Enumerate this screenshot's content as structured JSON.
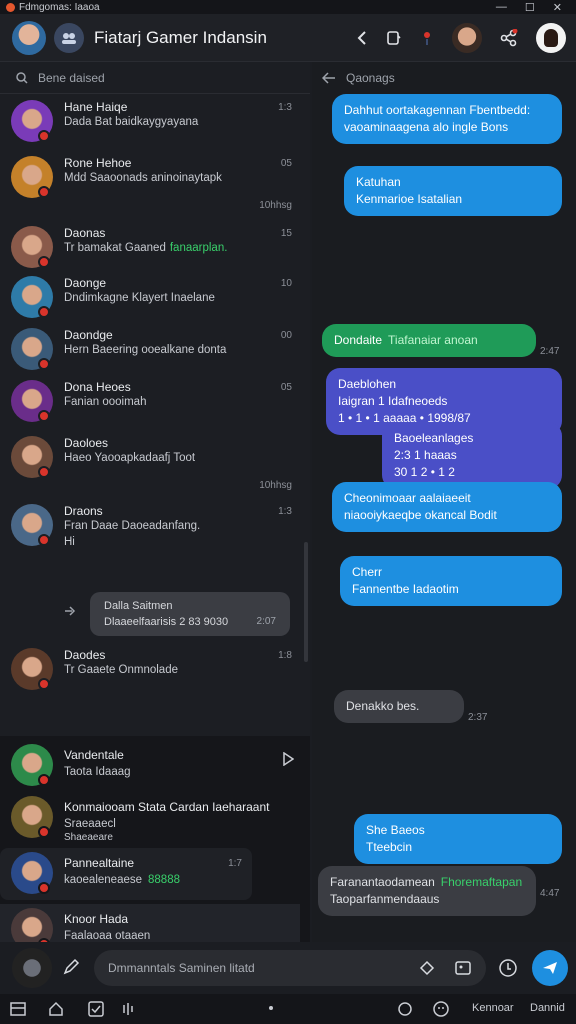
{
  "titlebar": {
    "app_title": "Fdmgomas: Iaaoa",
    "min": "—",
    "max": "☐",
    "close": "✕"
  },
  "header": {
    "title": "Fiatarj Gamer Indansin"
  },
  "left": {
    "search_text": "Bene daised",
    "conversations": [
      {
        "name": "Hane Haiqe",
        "preview": "Dada Bat baidkaygyayana",
        "time": "1:3",
        "color": "#7a3bb8"
      },
      {
        "name": "Rone Hehoe",
        "preview": "Mdd Saaoonads aninoinaytapk",
        "time": "05",
        "extra": "10hhsg",
        "color": "#c4812a"
      },
      {
        "name": "Daonas",
        "preview": "Tr bamakat Gaaned",
        "preview_green": "fanaarplan.",
        "time": "15",
        "color": "#8a5a4a"
      },
      {
        "name": "Daonge",
        "preview": "Dndimkagne Klayert Inaelane",
        "time": "10",
        "color": "#2e7ba8"
      },
      {
        "name": "Daondge",
        "preview": "Hern Baeering ooealkane donta",
        "time": "00",
        "color": "#3a5a78"
      },
      {
        "name": "Dona Heoes",
        "preview": "Fanian oooimah",
        "time": "05",
        "color": "#6a2d8a"
      },
      {
        "name": "Daoloes",
        "preview": "Haeo Yaooapkadaafj Toot",
        "time": "",
        "extra": "10hhsg",
        "color": "#6b4a3a"
      },
      {
        "name": "Draons",
        "preview": "Fran Daae Daoeadanfang.",
        "preview2": "Hi",
        "time": "1:3",
        "color": "#4a6888"
      },
      {
        "name": "Daodes",
        "preview": "Tr Gaaete Onmnolade",
        "time": "1:8",
        "color": "#5a3a2a"
      }
    ],
    "gray_card": {
      "line1": "Dalla Saitmen",
      "line2": "Dlaaeelfaarisis 2 83 9030",
      "time": "2:07"
    },
    "bottom": [
      {
        "name": "Vandentale",
        "preview": "Taota Idaaag",
        "time": "",
        "color": "#2d8a4a"
      },
      {
        "name": "Konmaiooam Stata Cardan Iaeharaant",
        "preview": "Sraeaaecl",
        "preview2": "Shaeaeare",
        "time": "",
        "color": "#6a5a2a"
      },
      {
        "name": "Pannealtaine",
        "preview": "kaoealeneaese",
        "preview_green": "88888",
        "time": "1:7",
        "color": "#2a4a8a"
      },
      {
        "name": "Knoor Hada",
        "preview": "Faalaoaa otaaen",
        "time": "",
        "color": "#4a3a3a"
      }
    ]
  },
  "right": {
    "head": "Qaonags",
    "messages": [
      {
        "text": "Dahhut oortakagennan Fbentbedd: vaoaminaagena alo ingle Bons",
        "time": ""
      },
      {
        "text": "Katuhan",
        "text2": "Kenmarioe Isatalian",
        "time": ""
      },
      {
        "text": "Dondaite",
        "text_green": "Tiafanaiar anoan",
        "time": "2:47"
      },
      {
        "text": "Daeblohen",
        "text2": "Iaigran 1 Idafneoeds",
        "text3": "1 • 1 • 1 aaaaa • 1998/87",
        "time": ""
      },
      {
        "text": "Baoeleanlages",
        "text2": "2:3 1 haaas",
        "text3": "30 1 2 • 1 2",
        "time": ""
      },
      {
        "text": "Cheonimoaar aalaiaeeit niaooiykaeqbe okancal Bodit",
        "time": ""
      },
      {
        "text": "Cherr",
        "text2": "Fannentbe Iadaotim",
        "time": ""
      },
      {
        "text": "Denakko bes.",
        "time": "2:37"
      },
      {
        "text": "She Baeos",
        "text2": "Tteebcin",
        "time": ""
      },
      {
        "text": "Faranantaodamean",
        "text_green": "Fhoremaftapan",
        "text2": "Taoparfanmendaaus",
        "time": "4:47"
      }
    ]
  },
  "composer": {
    "placeholder": "Dmmanntals Saminen litatd"
  },
  "navbar": {
    "left_label": "Kennoar",
    "right_label": "Dannid"
  },
  "colors": {
    "accent": "#1e8fe0",
    "green": "#1f9b58",
    "purple": "#4a4fc7",
    "badge": "#d9342b"
  }
}
